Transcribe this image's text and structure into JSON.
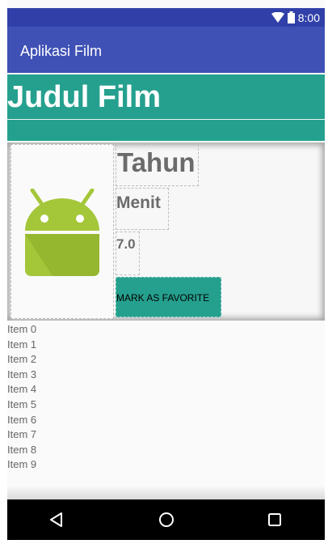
{
  "status_bar": {
    "time": "8:00",
    "icons": [
      "wifi-icon",
      "battery-icon"
    ]
  },
  "app_bar": {
    "title": "Aplikasi Film"
  },
  "banner": {
    "title": "Judul Film"
  },
  "detail": {
    "poster_icon": "android-icon",
    "year": "Tahun",
    "duration": "Menit",
    "rating": "7.0",
    "favorite_button": "MARK AS FAVORITE"
  },
  "list": {
    "items": [
      "Item 0",
      "Item 1",
      "Item 2",
      "Item 3",
      "Item 4",
      "Item 5",
      "Item 6",
      "Item 7",
      "Item 8",
      "Item 9"
    ]
  },
  "nav_bar": {
    "icons": [
      "back-icon",
      "home-icon",
      "recents-icon"
    ]
  },
  "colors": {
    "primary": "#3f51b5",
    "primary_dark": "#3040a8",
    "accent_teal": "#26a08e",
    "android_green": "#a4c639",
    "text_gray": "#6b6b6b"
  }
}
